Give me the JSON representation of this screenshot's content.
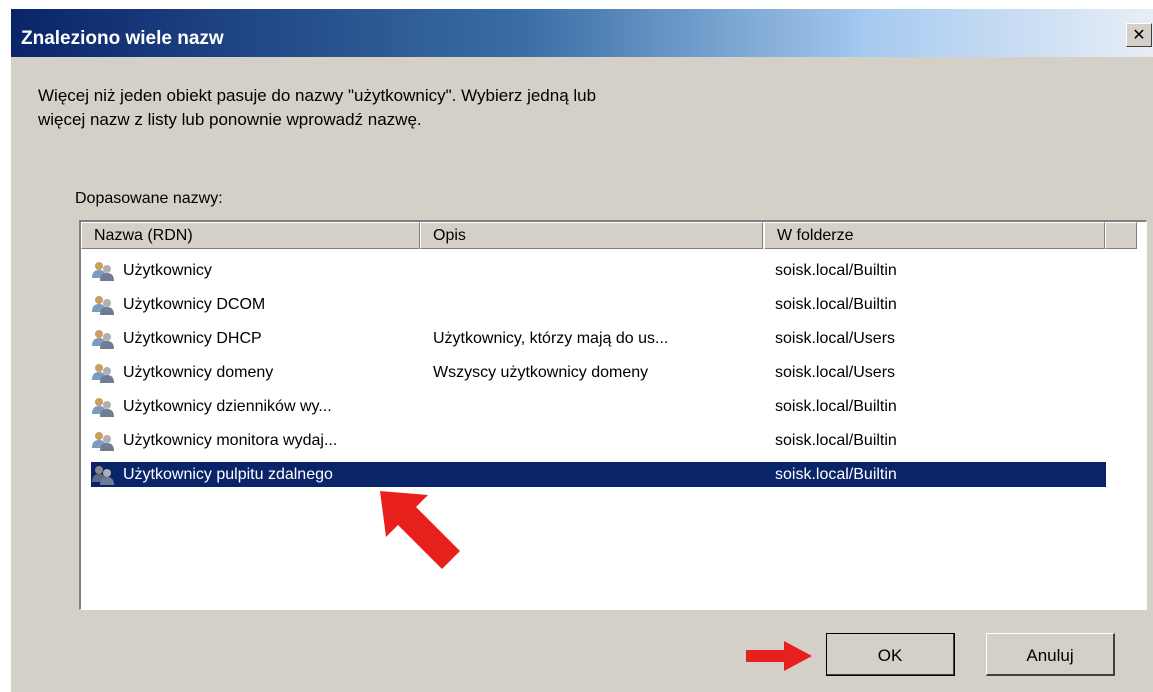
{
  "window": {
    "title": "Znaleziono wiele nazw",
    "close_glyph": "✕"
  },
  "message": {
    "line1": "Więcej niż jeden obiekt pasuje do nazwy \"użytkownicy\". Wybierz jedną lub",
    "line2": "więcej nazw z listy lub ponownie wprowadź nazwę."
  },
  "list": {
    "label": "Dopasowane nazwy:",
    "columns": [
      "Nazwa (RDN)",
      "Opis",
      "W folderze"
    ],
    "rows": [
      {
        "name": "Użytkownicy",
        "desc": "",
        "folder": "soisk.local/Builtin",
        "icon": "group-icon",
        "selected": false
      },
      {
        "name": "Użytkownicy DCOM",
        "desc": "",
        "folder": "soisk.local/Builtin",
        "icon": "group-icon",
        "selected": false
      },
      {
        "name": "Użytkownicy DHCP",
        "desc": "Użytkownicy, którzy mają do us...",
        "folder": "soisk.local/Users",
        "icon": "group-icon",
        "selected": false
      },
      {
        "name": "Użytkownicy domeny",
        "desc": "Wszyscy użytkownicy domeny",
        "folder": "soisk.local/Users",
        "icon": "group-icon",
        "selected": false
      },
      {
        "name": "Użytkownicy dzienników wy...",
        "desc": "",
        "folder": "soisk.local/Builtin",
        "icon": "group-icon",
        "selected": false
      },
      {
        "name": "Użytkownicy monitora wydaj...",
        "desc": "",
        "folder": "soisk.local/Builtin",
        "icon": "group-icon",
        "selected": false
      },
      {
        "name": "Użytkownicy pulpitu zdalnego",
        "desc": "",
        "folder": "soisk.local/Builtin",
        "icon": "group-icon",
        "selected": true
      }
    ]
  },
  "buttons": {
    "ok": "OK",
    "cancel": "Anuluj"
  },
  "colors": {
    "dialog_bg": "#d4d0c8",
    "title_bar": "#0a246a",
    "selection": "#0a246a",
    "arrow": "#e8201c"
  }
}
